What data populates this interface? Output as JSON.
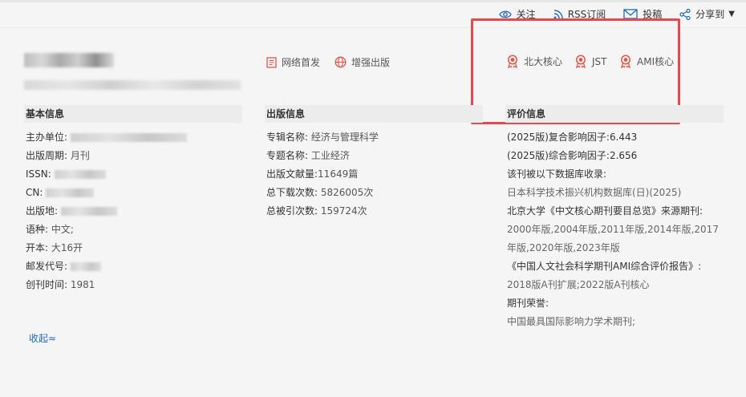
{
  "toolbar": {
    "follow": "关注",
    "rss": "RSS订阅",
    "submit": "投稿",
    "share": "分享到"
  },
  "badges": {
    "online_first": "网络首发",
    "enhanced_publish": "增强出版",
    "pku_core": "北大核心",
    "jst": "JST",
    "ami_core": "AMI核心"
  },
  "sections": {
    "basic": "基本信息",
    "publish": "出版信息",
    "evaluation": "评价信息"
  },
  "basic_info": {
    "sponsor_label": "主办单位:",
    "period_label": "出版周期:",
    "period_value": "月刊",
    "issn_label": "ISSN:",
    "cn_label": "CN:",
    "place_label": "出版地:",
    "language_label": "语种:",
    "language_value": "中文;",
    "format_label": "开本:",
    "format_value": "大16开",
    "postcode_label": "邮发代号:",
    "founded_label": "创刊时间:",
    "founded_value": "1981"
  },
  "publish_info": {
    "album_label": "专辑名称:",
    "album_value": "经济与管理科学",
    "topic_label": "专题名称:",
    "topic_value": "工业经济",
    "docs_label": "出版文献量:",
    "docs_value": "11649篇",
    "downloads_label": "总下载次数:",
    "downloads_value": "5826005次",
    "citations_label": "总被引次数:",
    "citations_value": "159724次"
  },
  "evaluation": {
    "composite_if_label": "(2025版)复合影响因子:",
    "composite_if_value": "6.443",
    "comprehensive_if_label": "(2025版)综合影响因子:",
    "comprehensive_if_value": "2.656",
    "db_included_label": "该刊被以下数据库收录:",
    "db_included_value": "日本科学技术振兴机构数据库(日)(2025)",
    "pku_label": "北京大学《中文核心期刊要目总览》来源期刊:",
    "pku_value": "2000年版,2004年版,2011年版,2014年版,2017年版,2020年版,2023年版",
    "ami_label": "《中国人文社会科学期刊AMI综合评价报告》:",
    "ami_value": "2018版A刊扩展;2022版A刊核心",
    "honors_label": "期刊荣誉:",
    "honors_value": "中国最具国际影响力学术期刊;"
  },
  "collapse_label": "收起≈",
  "colors": {
    "accent_blue": "#1e6bb8",
    "badge_red": "#e0584a",
    "highlight_box": "#e5484d"
  }
}
